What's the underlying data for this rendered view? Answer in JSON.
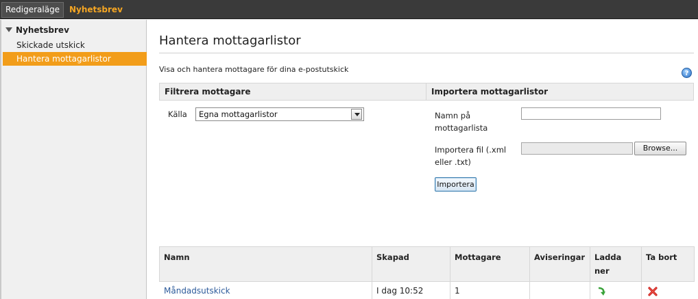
{
  "topbar": {
    "mode_label": "Redigeraläge",
    "title": "Nyhetsbrev"
  },
  "sidebar": {
    "section": "Nyhetsbrev",
    "items": [
      {
        "label": "Skickade utskick",
        "selected": false
      },
      {
        "label": "Hantera mottagarlistor",
        "selected": true
      }
    ]
  },
  "main": {
    "title": "Hantera mottagarlistor",
    "description": "Visa och hantera mottagare för dina e-postutskick",
    "help_icon": "question-circle-icon"
  },
  "filter": {
    "heading": "Filtrera mottagare",
    "source_label": "Källa",
    "source_value": "Egna mottagarlistor"
  },
  "import": {
    "heading": "Importera mottagarlistor",
    "name_label_line1": "Namn på",
    "name_label_line2": "mottagarlista",
    "name_value": "",
    "file_label_line1": "Importera fil (.xml",
    "file_label_line2": "eller .txt)",
    "browse_label": "Browse...",
    "submit_label": "Importera"
  },
  "table": {
    "columns": [
      "Namn",
      "Skapad",
      "Mottagare",
      "Aviseringar",
      "Ladda ner",
      "Ta bort"
    ],
    "download_header_line1": "Ladda",
    "download_header_line2": "ner",
    "rows": [
      {
        "name": "Måndadsutskick",
        "created": "I dag 10:52",
        "recipients": "1",
        "notifications": "",
        "download_icon": "download-arrow-icon",
        "delete_icon": "delete-x-icon"
      }
    ]
  },
  "colors": {
    "accent_orange": "#f29d1a",
    "topbar_bg": "#3a3a3a",
    "link_blue": "#2d5b9b"
  }
}
